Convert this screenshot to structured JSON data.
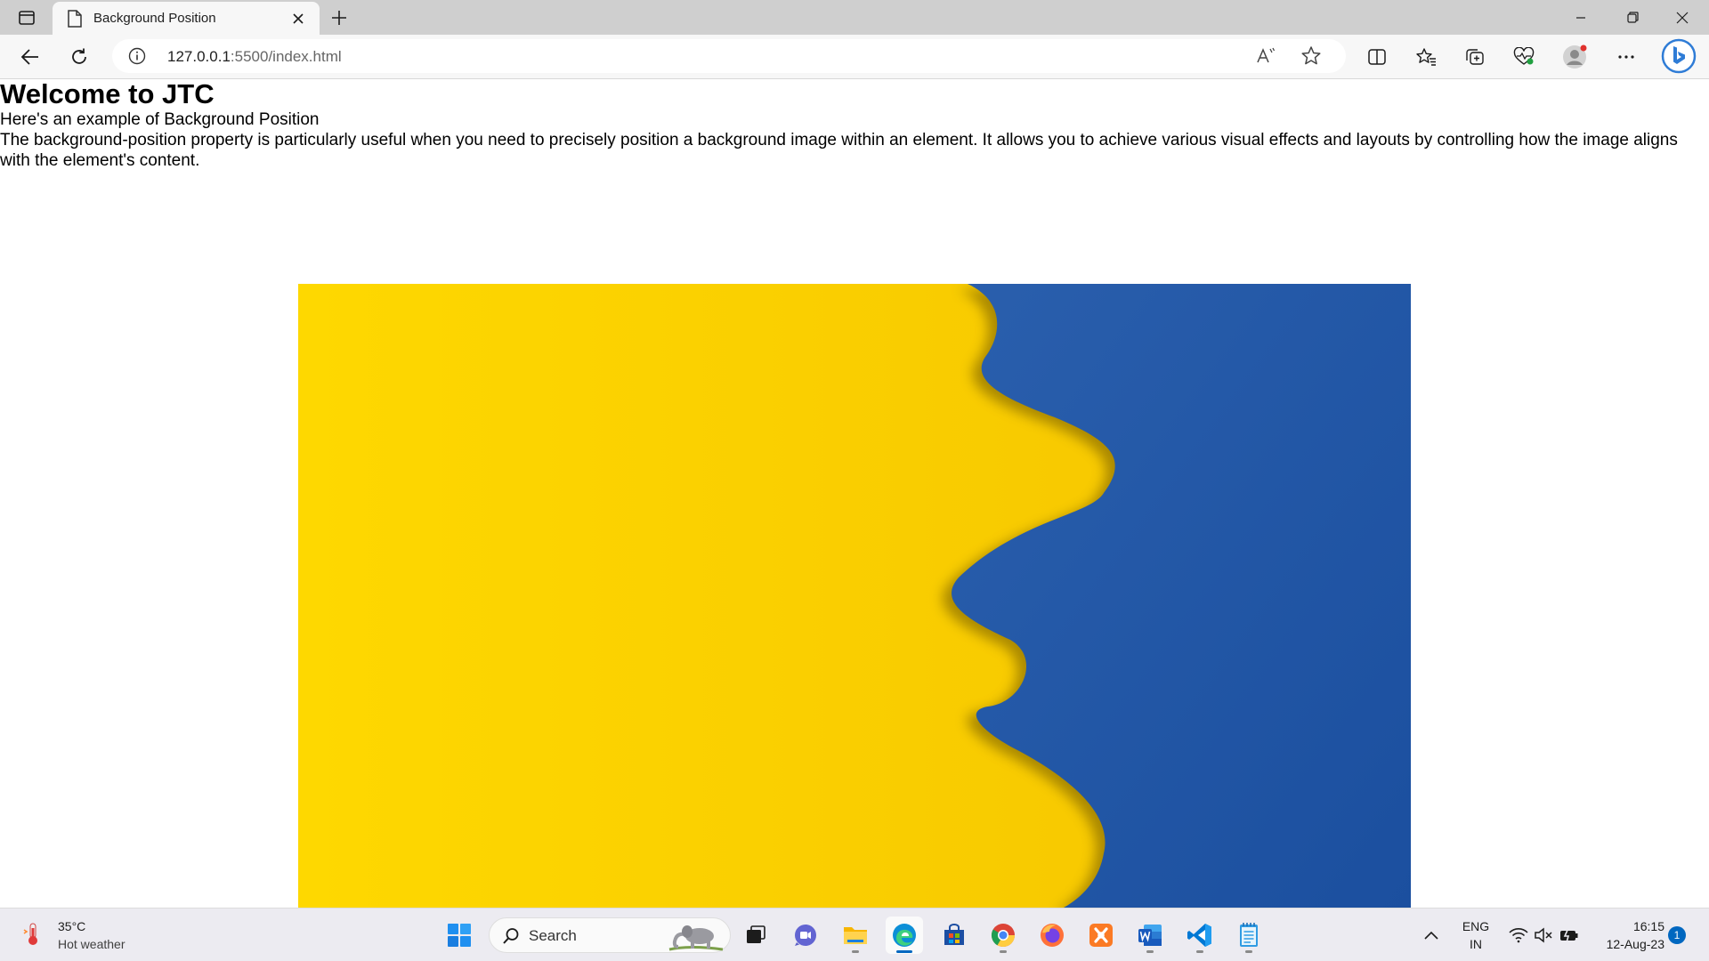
{
  "browser": {
    "tab": {
      "title": "Background Position"
    },
    "address": {
      "host": "127.0.0.1",
      "path": ":5500/index.html"
    }
  },
  "page": {
    "heading": "Welcome to JTC",
    "subheading": "Here's an example of Background Position",
    "paragraph": "The background-position property is particularly useful when you need to precisely position a background image within an element. It allows you to achieve various visual effects and layouts by controlling how the image aligns with the element's content.",
    "image": {
      "colors": {
        "left": "#ffd400",
        "right": "#1f58a8"
      }
    }
  },
  "taskbar": {
    "weather": {
      "temp": "35°C",
      "desc": "Hot weather"
    },
    "search_label": "Search",
    "apps": [
      "start-icon",
      "search",
      "task-view-icon",
      "teams-chat-icon",
      "file-explorer-icon",
      "edge-icon",
      "store-icon",
      "chrome-icon",
      "firefox-icon",
      "xampp-icon",
      "word-icon",
      "vscode-icon",
      "notepad-icon"
    ],
    "tray": {
      "lang_line1": "ENG",
      "lang_line2": "IN",
      "time": "16:15",
      "date": "12-Aug-23",
      "notification_count": "1"
    }
  }
}
